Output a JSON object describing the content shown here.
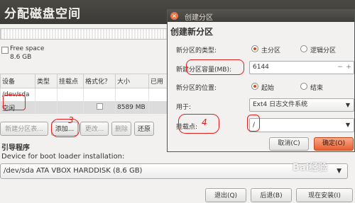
{
  "window": {
    "title": "分配磁盘空间"
  },
  "legend": {
    "label": "Free space",
    "size": "8.6 GB"
  },
  "table": {
    "headers": [
      "设备",
      "类型",
      "挂载点",
      "格式化？",
      "大小",
      "已用"
    ],
    "rows": [
      {
        "device": "/dev/sda",
        "type": "",
        "mount": "",
        "format": "",
        "size": "",
        "used": ""
      },
      {
        "device": "空闲",
        "type": "",
        "mount": "",
        "format": "",
        "size": "8589 MB",
        "used": ""
      }
    ]
  },
  "buttons": {
    "new_table": "新建分区表...",
    "add": "添加...",
    "change": "更改...",
    "delete": "删除",
    "revert": "还原"
  },
  "bootloader": {
    "title": "引导程序",
    "label": "Device for boot loader installation:",
    "device": "/dev/sda ATA VBOX HARDDISK (8.6 GB)"
  },
  "footer": {
    "quit": "退出(Q)",
    "back": "后退(B)",
    "install": "现在安装(I)"
  },
  "dialog": {
    "title": "创建分区",
    "heading": "创建新分区",
    "type_label": "新分区的类型:",
    "type_primary": "主分区",
    "type_logical": "逻辑分区",
    "size_label": "新建分区容量(MB):",
    "size_value": "6144",
    "position_label": "新分区的位置:",
    "position_start": "起始",
    "position_end": "结束",
    "use_label": "用于:",
    "use_value": "Ext4 日志文件系统",
    "mount_label": "挂载点:",
    "mount_value": "/",
    "cancel": "取消(C)",
    "ok": "确定(O)"
  },
  "annotations": {
    "mark_add": "3",
    "mark_mount": "4"
  },
  "watermark": "Bai经验"
}
